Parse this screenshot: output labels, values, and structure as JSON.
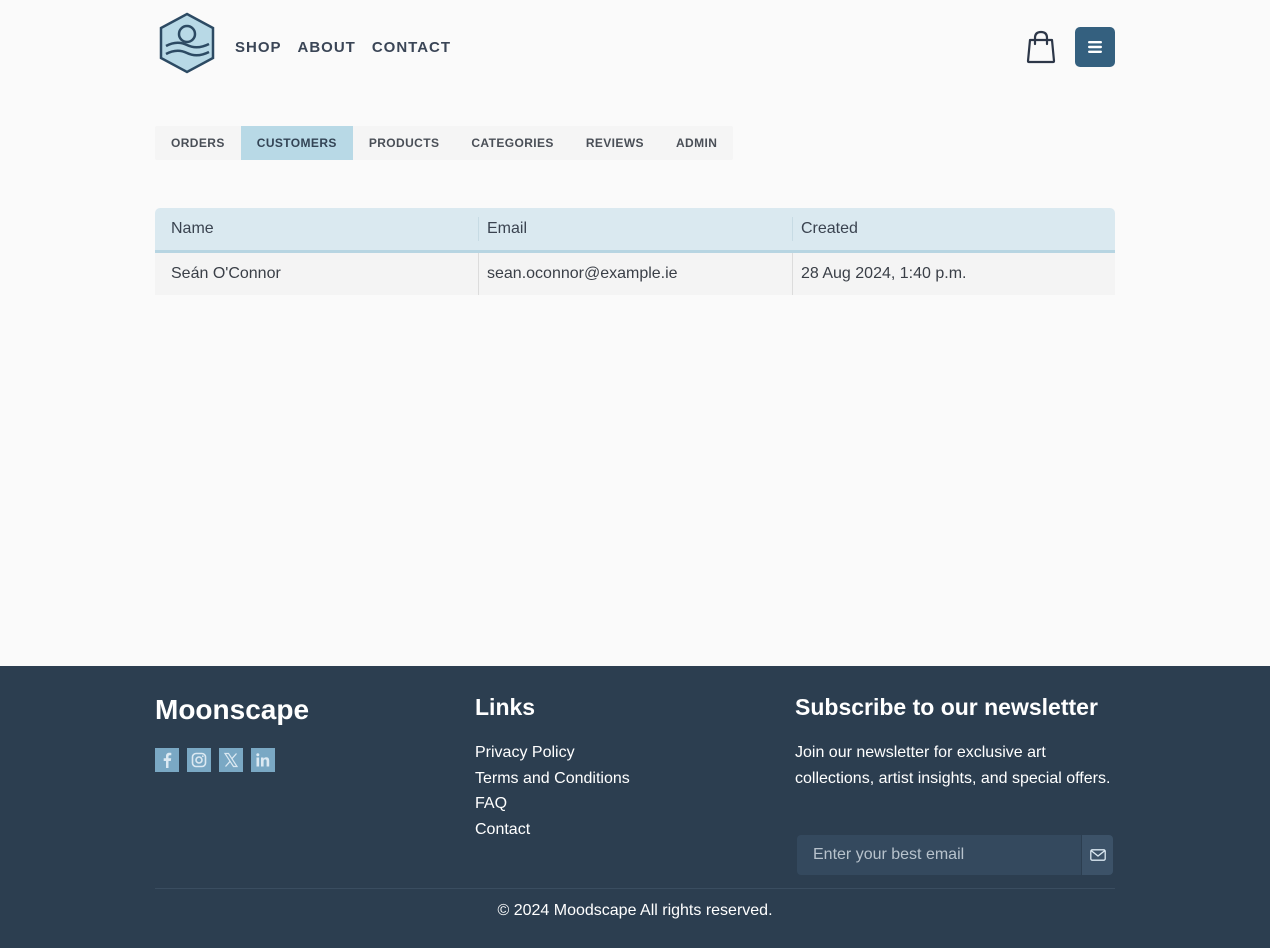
{
  "header": {
    "nav": [
      "SHOP",
      "ABOUT",
      "CONTACT"
    ],
    "logo_icon": "moonscape-hexagon-logo",
    "cart_icon": "shopping-bag-icon",
    "menu_icon": "hamburger-menu-icon",
    "accent_color": "#34607f"
  },
  "tabs": {
    "items": [
      "ORDERS",
      "CUSTOMERS",
      "PRODUCTS",
      "CATEGORIES",
      "REVIEWS",
      "ADMIN"
    ],
    "active": "CUSTOMERS",
    "active_color": "#b8d9e6"
  },
  "table": {
    "headers": [
      "Name",
      "Email",
      "Created"
    ],
    "rows": [
      [
        "Seán O'Connor",
        "sean.oconnor@example.ie",
        "28 Aug 2024, 1:40 p.m."
      ]
    ]
  },
  "footer": {
    "brand": "Moonscape",
    "socials": [
      "facebook-icon",
      "instagram-icon",
      "x-twitter-icon",
      "linkedin-icon"
    ],
    "links_title": "Links",
    "links": [
      "Privacy Policy",
      "Terms and Conditions",
      "FAQ",
      "Contact"
    ],
    "newsletter_title": "Subscribe to our newsletter",
    "newsletter_text": "Join our newsletter for exclusive art collections, artist insights, and special offers.",
    "email_placeholder": "Enter your best email",
    "submit_icon": "envelope-icon",
    "copyright": "© 2024 Moodscape All rights reserved.",
    "background_color": "#2c3e50"
  }
}
